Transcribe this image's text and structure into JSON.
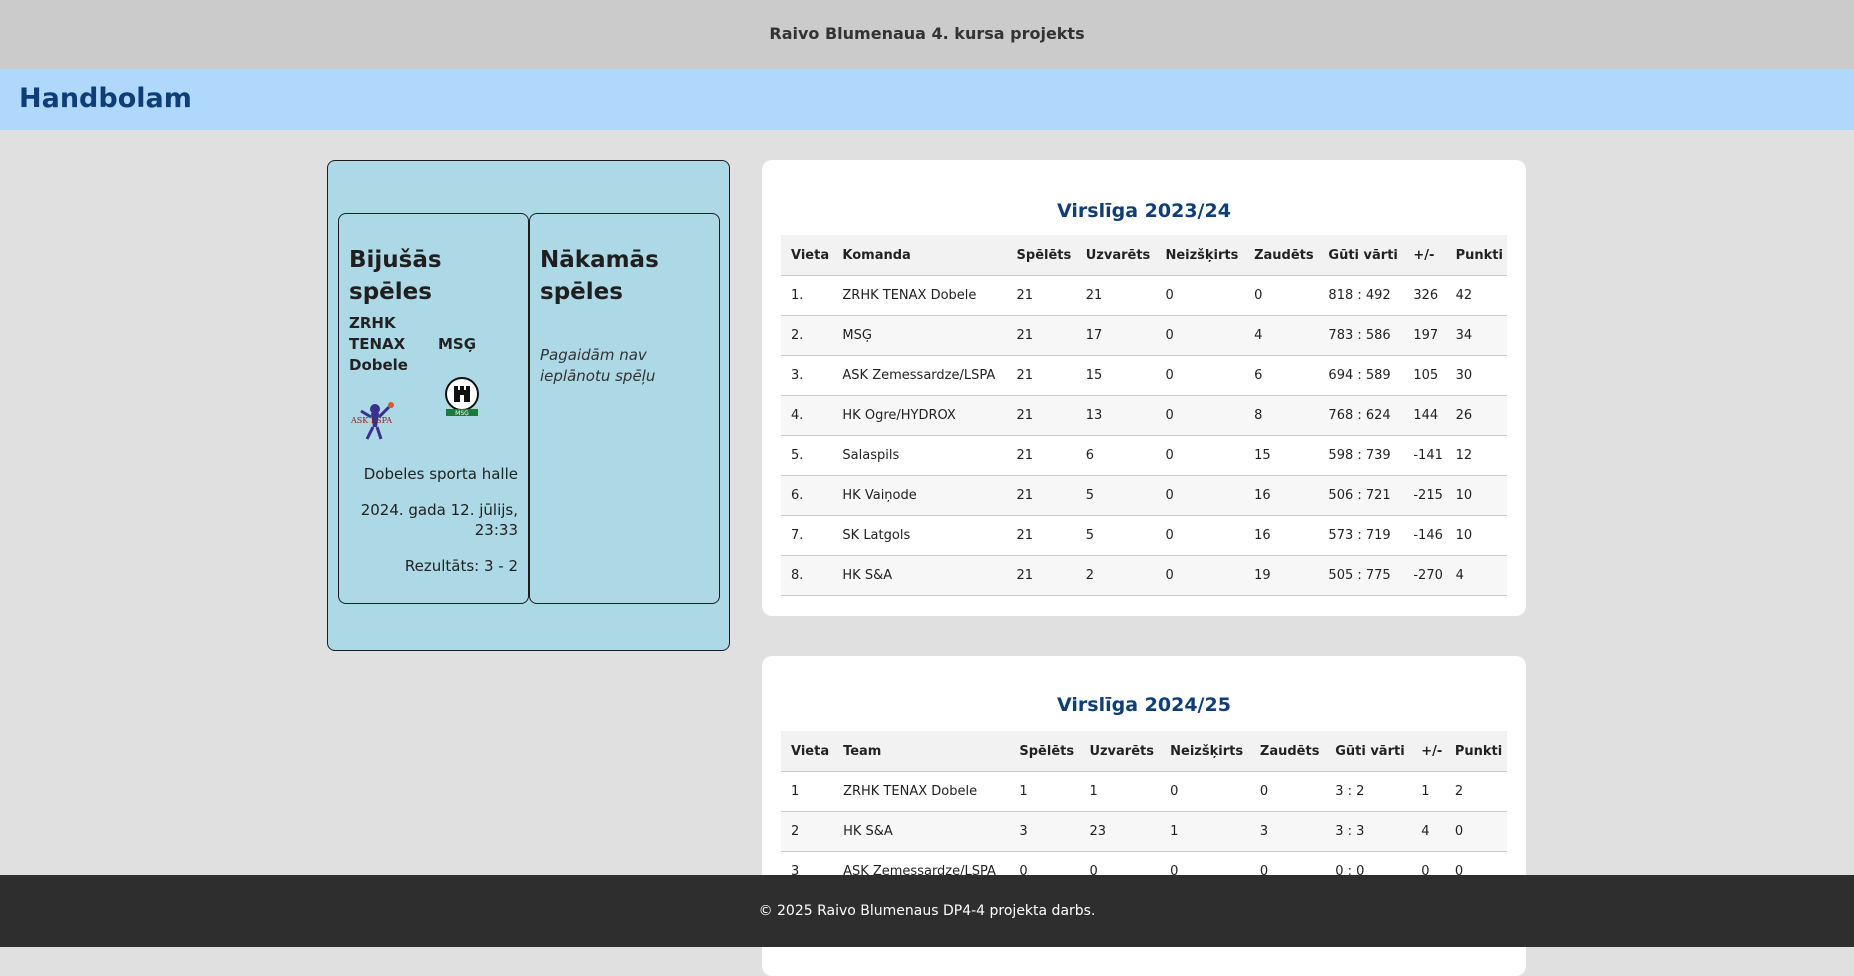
{
  "header": {
    "site_title": "Raivo Blumenaua 4. kursa projekts"
  },
  "page": {
    "title": "Handbolam"
  },
  "past_games": {
    "heading": "Bijušās spēles",
    "home_team": "ZRHK TENAX Dobele",
    "away_team": "MSĢ",
    "home_logo_text": "ASK LSPA",
    "away_logo_text": "MSĢ",
    "venue": "Dobeles sporta halle",
    "date": "2024. gada 12. jūlijs, 23:33",
    "result": "Rezultāts: 3 - 2"
  },
  "upcoming_games": {
    "heading": "Nākamās spēles",
    "empty_text": "Pagaidām nav ieplānotu spēļu"
  },
  "league_2023": {
    "title": "Virslīga 2023/24",
    "columns": [
      "Vieta",
      "Komanda",
      "Spēlēts",
      "Uzvarēts",
      "Neizšķirts",
      "Zaudēts",
      "Gūti vārti",
      "+/-",
      "Punkti"
    ],
    "rows": [
      [
        "1.",
        "ZRHK TENAX Dobele",
        "21",
        "21",
        "0",
        "0",
        "818 : 492",
        "326",
        "42"
      ],
      [
        "2.",
        "MSĢ",
        "21",
        "17",
        "0",
        "4",
        "783 : 586",
        "197",
        "34"
      ],
      [
        "3.",
        "ASK Zemessardze/LSPA",
        "21",
        "15",
        "0",
        "6",
        "694 : 589",
        "105",
        "30"
      ],
      [
        "4.",
        "HK Ogre/HYDROX",
        "21",
        "13",
        "0",
        "8",
        "768 : 624",
        "144",
        "26"
      ],
      [
        "5.",
        "Salaspils",
        "21",
        "6",
        "0",
        "15",
        "598 : 739",
        "-141",
        "12"
      ],
      [
        "6.",
        "HK Vaiņode",
        "21",
        "5",
        "0",
        "16",
        "506 : 721",
        "-215",
        "10"
      ],
      [
        "7.",
        "SK Latgols",
        "21",
        "5",
        "0",
        "16",
        "573 : 719",
        "-146",
        "10"
      ],
      [
        "8.",
        "HK S&A",
        "21",
        "2",
        "0",
        "19",
        "505 : 775",
        "-270",
        "4"
      ]
    ]
  },
  "league_2024": {
    "title": "Virslīga 2024/25",
    "columns": [
      "Vieta",
      "Team",
      "Spēlēts",
      "Uzvarēts",
      "Neizšķirts",
      "Zaudēts",
      "Gūti vārti",
      "+/-",
      "Punkti"
    ],
    "rows": [
      [
        "1",
        "ZRHK TENAX Dobele",
        "1",
        "1",
        "0",
        "0",
        "3 : 2",
        "1",
        "2"
      ],
      [
        "2",
        "HK S&A",
        "3",
        "23",
        "1",
        "3",
        "3 : 3",
        "4",
        "0"
      ],
      [
        "3",
        "ASK Zemessardze/LSPA",
        "0",
        "0",
        "0",
        "0",
        "0 : 0",
        "0",
        "0"
      ]
    ]
  },
  "footer": {
    "text": "© 2025 Raivo Blumenaus DP4-4 projekta darbs."
  },
  "colors": {
    "topbar": "#cbcbcb",
    "titlebar": "#b0d8fc",
    "title_text": "#0e3d78",
    "games_panel": "#add8e6",
    "footer": "#2e2e2e"
  }
}
